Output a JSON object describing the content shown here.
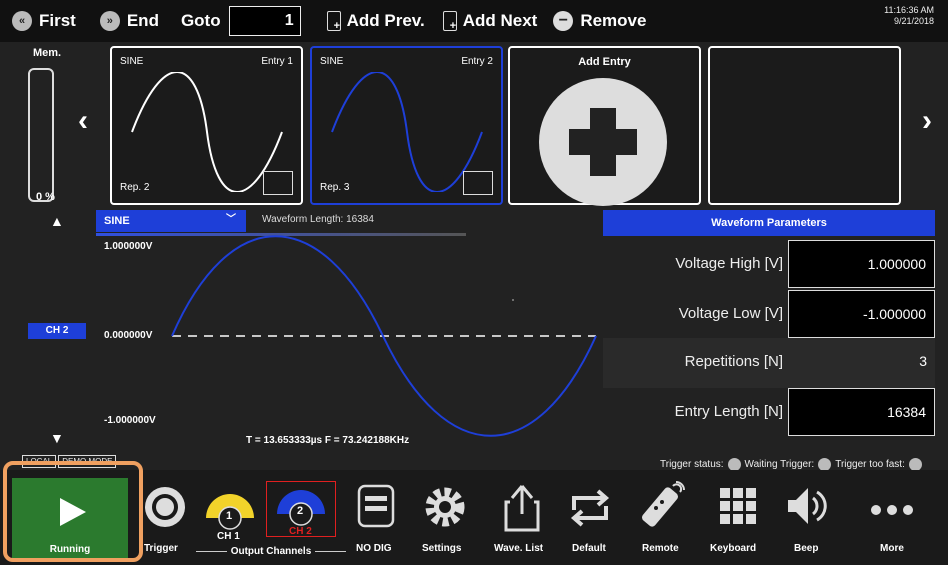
{
  "toolbar": {
    "first_label": "First",
    "end_label": "End",
    "goto_label": "Goto",
    "goto_value": "1",
    "add_prev_label": "Add Prev.",
    "add_next_label": "Add Next",
    "remove_label": "Remove"
  },
  "clock": {
    "time": "11:16:36 AM",
    "date": "9/21/2018"
  },
  "memory": {
    "label": "Mem.",
    "percent": "0 %"
  },
  "entries": [
    {
      "name": "SINE",
      "entry": "Entry 1",
      "repetitions": "Rep. 2"
    },
    {
      "name": "SINE",
      "entry": "Entry 2",
      "repetitions": "Rep. 3"
    }
  ],
  "add_entry_label": "Add Entry",
  "waveform": {
    "type": "SINE",
    "length_label": "Waveform Length: 16384",
    "channel": "CH 2",
    "v_high": "1.000000V",
    "v_mid": "0.000000V",
    "v_low": "-1.000000V",
    "period_freq": "T =  13.653333µs  F =  73.242188KHz",
    "local_label": "LOCAL",
    "demo_label": "DEMO MODE",
    "line_color": "#1e3fd8"
  },
  "params": {
    "header": "Waveform Parameters",
    "rows": [
      {
        "label": "Voltage High [V]",
        "value": "1.000000"
      },
      {
        "label": "Voltage Low [V]",
        "value": "-1.000000"
      },
      {
        "label": "Repetitions [N]",
        "value": "3"
      },
      {
        "label": "Entry Length [N]",
        "value": "16384"
      }
    ]
  },
  "trigger": {
    "status": "Trigger status:",
    "waiting": "Waiting Trigger:",
    "too_fast": "Trigger too fast:"
  },
  "bottom": {
    "running": "Running",
    "trigger": "Trigger",
    "ch1": "CH 1",
    "ch2": "CH 2",
    "ch1_num": "1",
    "ch2_num": "2",
    "output_channels": "Output Channels",
    "nodig": "NO DIG",
    "settings": "Settings",
    "wavelist": "Wave. List",
    "default": "Default",
    "remote": "Remote",
    "keyboard": "Keyboard",
    "beep": "Beep",
    "more": "More"
  },
  "colors": {
    "accent": "#1e3fd8",
    "running": "#2b7a2e",
    "ch1": "#f2d32a",
    "ch2": "#1e3fd8",
    "ch2_label": "#e02020",
    "highlight": "#f0a060"
  }
}
